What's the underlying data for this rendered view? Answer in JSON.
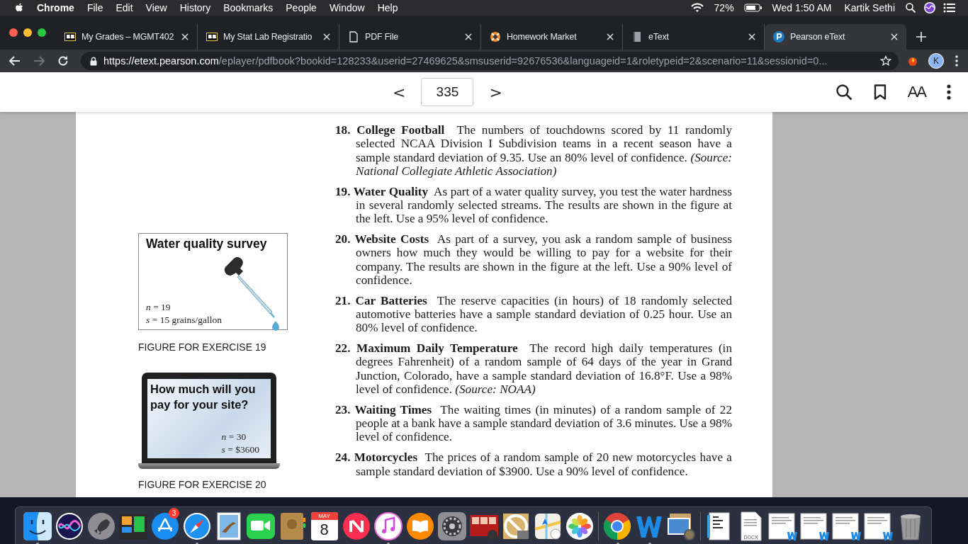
{
  "menu_bar": {
    "app": "Chrome",
    "menus": [
      "File",
      "Edit",
      "View",
      "History",
      "Bookmarks",
      "People",
      "Window",
      "Help"
    ],
    "battery": "72%",
    "clock": "Wed 1:50 AM",
    "user": "Kartik Sethi"
  },
  "tabs": [
    {
      "title": "My Grades – MGMT402",
      "kind": "bb",
      "selected": false
    },
    {
      "title": "My Stat Lab Registratio",
      "kind": "bb",
      "selected": false
    },
    {
      "title": "PDF File",
      "kind": "document",
      "selected": false
    },
    {
      "title": "Homework Market",
      "kind": "lifebuoy",
      "selected": false
    },
    {
      "title": "eText",
      "kind": "book",
      "selected": false
    },
    {
      "title": "Pearson eText",
      "kind": "pearson",
      "selected": true
    }
  ],
  "nav_buttons": [
    {
      "kind": "back",
      "disabled": false
    },
    {
      "kind": "forward",
      "disabled": true
    },
    {
      "kind": "reload",
      "disabled": false
    }
  ],
  "address": {
    "host": "https://etext.pearson.com",
    "path": "/eplayer/pdfbook?bookid=128233&userid=27469625&smsuserid=92676536&languageid=1&roletypeid=2&scenario=11&sessionid=0..."
  },
  "profile_initial": "K",
  "reader_toolbar": {
    "prev": "<",
    "page": "335",
    "next": ">",
    "font_button": "AA"
  },
  "figures": [
    {
      "kind": "dropper",
      "title": "Water quality survey",
      "lines": [
        "*n* = 19",
        "*s* = 15 grains/gallon"
      ],
      "caption": "FIGURE FOR EXERCISE 19"
    },
    {
      "kind": "laptop",
      "title": "How much will you pay for your site?",
      "lines": [
        "*n* = 30",
        "*s* = $3600"
      ],
      "caption": "FIGURE FOR EXERCISE 20"
    }
  ],
  "exercises": [
    "**18. College Football**  The numbers of touchdowns scored by 11 randomly selected NCAA Division I Subdivision teams in a recent season have a sample standard deviation of 9.35. Use an 80% level of confidence. *(Source: National Collegiate Athletic Association)*",
    "**19. Water Quality**  As part of a water quality survey, you test the water hardness in several randomly selected streams. The results are shown in the figure at the left. Use a 95% level of confidence.",
    "**20. Website Costs**  As part of a survey, you ask a random sample of business owners how much they would be willing to pay for a website for their company. The results are shown in the figure at the left. Use a 90% level of confidence.",
    "**21. Car Batteries**  The reserve capacities (in hours) of 18 randomly selected automotive batteries have a sample standard deviation of 0.25 hour. Use an 80% level of confidence.",
    "**22. Maximum Daily Temperature**  The record high daily temperatures (in degrees Fahrenheit) of a random sample of 64 days of the year in Grand Junction, Colorado, have a sample standard deviation of 16.8°F. Use a 98% level of confidence. *(Source: NOAA)*",
    "**23. Waiting Times**  The waiting times (in minutes) of a random sample of 22 people at a bank have a sample standard deviation of 3.6 minutes. Use a 98% level of confidence.",
    "**24. Motorcycles**  The prices of a random sample of 20 new motorcycles have a sample standard deviation of $3900. Use a 90% level of confidence."
  ],
  "dock": {
    "items": [
      {
        "kind": "finder",
        "running": true
      },
      {
        "kind": "siri",
        "running": false
      },
      {
        "kind": "launchpad",
        "running": false
      },
      {
        "kind": "mission",
        "running": false
      },
      {
        "kind": "appstore",
        "running": false,
        "badge": "3"
      },
      {
        "kind": "safari",
        "running": true
      },
      {
        "kind": "mail",
        "running": false
      },
      {
        "kind": "facetime",
        "running": false
      },
      {
        "kind": "contacts",
        "running": false
      },
      {
        "kind": "calendar",
        "running": false,
        "month": "MAY",
        "day": "8"
      },
      {
        "kind": "news",
        "running": false
      },
      {
        "kind": "music",
        "running": true
      },
      {
        "kind": "books",
        "running": false
      },
      {
        "kind": "settings",
        "running": false
      },
      {
        "kind": "photobooth",
        "running": false
      },
      {
        "kind": "blocked",
        "running": false
      },
      {
        "kind": "maps",
        "running": false
      },
      {
        "kind": "photos",
        "running": false
      },
      {
        "kind": "separator"
      },
      {
        "kind": "chrome",
        "running": true
      },
      {
        "kind": "word",
        "running": true
      },
      {
        "kind": "preview",
        "running": false
      },
      {
        "kind": "separator"
      },
      {
        "kind": "binder"
      },
      {
        "kind": "docx",
        "label": "DOCX"
      },
      {
        "kind": "worddoc"
      },
      {
        "kind": "worddoc"
      },
      {
        "kind": "worddoc"
      },
      {
        "kind": "worddoc"
      },
      {
        "kind": "trash"
      }
    ]
  }
}
